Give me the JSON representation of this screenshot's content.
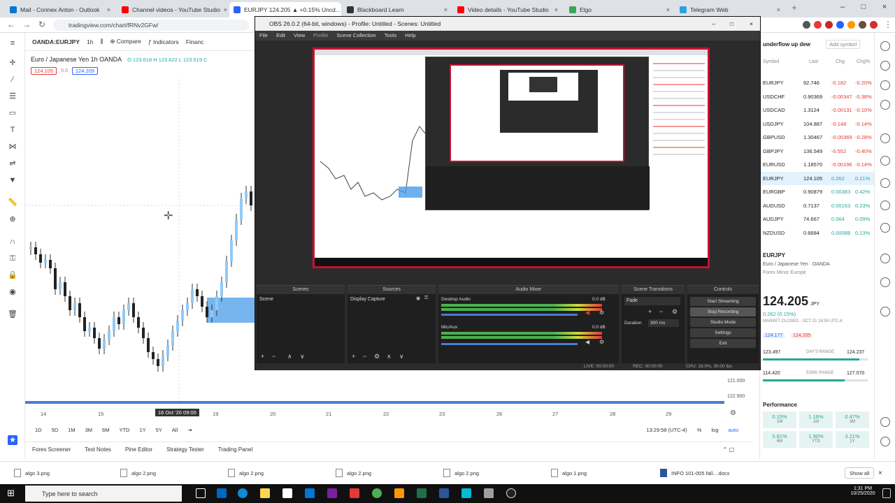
{
  "browser": {
    "tabs": [
      {
        "label": "Mail - Corinex Anton - Outlook",
        "fav": "#0078d4"
      },
      {
        "label": "Channel videos - YouTube Studio",
        "fav": "#ff0000"
      },
      {
        "label": "EURJPY 124.205 ▲ +0.15% Uncd...",
        "fav": "#2962ff"
      },
      {
        "label": "Blackboard Learn",
        "fav": "#333333"
      },
      {
        "label": "Video details - YouTube Studio",
        "fav": "#ff0000"
      },
      {
        "label": "Elgo",
        "fav": "#34a853"
      },
      {
        "label": "Telegram Web",
        "fav": "#2aa3df"
      }
    ],
    "url": "tradingview.com/chart/fRNv2GFw/"
  },
  "tv": {
    "symbol": "OANDA:EURJPY",
    "interval": "1h",
    "compare": "Compare",
    "indicators": "Indicators",
    "financials": "Financ",
    "pair_title": "Euro / Japanese Yen   1h   OANDA",
    "ohlc": "O 123.618  H 123.622  L 123.519  C",
    "sell_price": "124.105",
    "spread": "0.0",
    "buy_price": "124.209",
    "time_labels": [
      "14",
      "15",
      "16 Oct '20  09:00",
      "19",
      "20",
      "21",
      "22",
      "23",
      "26",
      "27",
      "28",
      "29"
    ],
    "price_labels": [
      "121.000",
      "122.900"
    ],
    "ranges": [
      "1D",
      "5D",
      "1M",
      "3M",
      "6M",
      "YTD",
      "1Y",
      "5Y",
      "All"
    ],
    "clock": "13:29:58 (UTC-4)",
    "log": "log",
    "auto": "auto",
    "bottom_tabs": [
      "Forex Screener",
      "Text Notes",
      "Pine Editor",
      "Strategy Tester",
      "Trading Panel"
    ]
  },
  "watchlist": {
    "title": "underflow up dew",
    "add_symbol": "Add symbol",
    "headers": [
      "Symbol",
      "Last",
      "Chg",
      "Chg%"
    ],
    "rows": [
      {
        "sym": "EURJPY",
        "last": "92.746",
        "chg": "-0.182",
        "pct": "-0.20%",
        "color": "#e53935"
      },
      {
        "sym": "USDCHF",
        "last": "0.90369",
        "chg": "-0.00347",
        "pct": "-0.38%",
        "color": "#e53935"
      },
      {
        "sym": "USDCAD",
        "last": "1.3124",
        "chg": "-0.00131",
        "pct": "-0.10%",
        "color": "#e53935"
      },
      {
        "sym": "USDJPY",
        "last": "104.887",
        "chg": "-0.148",
        "pct": "-0.14%",
        "color": "#e53935"
      },
      {
        "sym": "GBPUSD",
        "last": "1.30467",
        "chg": "-0.00369",
        "pct": "-0.28%",
        "color": "#e53935"
      },
      {
        "sym": "GBPJPY",
        "last": "136.549",
        "chg": "-0.552",
        "pct": "-0.40%",
        "color": "#e53935"
      },
      {
        "sym": "EURUSD",
        "last": "1.18570",
        "chg": "-0.00196",
        "pct": "-0.14%",
        "color": "#e53935"
      },
      {
        "sym": "EURJPY",
        "last": "124.105",
        "chg": "0.262",
        "pct": "0.21%",
        "color": "#26a69a"
      },
      {
        "sym": "EURGBP",
        "last": "0.90879",
        "chg": "0.00383",
        "pct": "0.42%",
        "color": "#26a69a"
      },
      {
        "sym": "AUDUSD",
        "last": "0.7137",
        "chg": "0.00163",
        "pct": "0.23%",
        "color": "#26a69a"
      },
      {
        "sym": "AUDJPY",
        "last": "74.667",
        "chg": "0.064",
        "pct": "0.09%",
        "color": "#26a69a"
      },
      {
        "sym": "NZDUSD",
        "last": "0.6684",
        "chg": "0.00088",
        "pct": "0.13%",
        "color": "#26a69a"
      }
    ],
    "detail_symbol": "EURJPY",
    "detail_name": "Euro / Japanese Yen · OANDA",
    "detail_sub": "Forex  Minor  Europe",
    "big_price": "124.205",
    "big_unit": "JPY",
    "big_change": "0.262 (0.15%)",
    "market_status": "MARKET CLOSED · OCT 21 16:59 UTC-4",
    "bid": "124.177",
    "ask": "124.205",
    "day_low": "123.497",
    "day_range_label": "DAY'S RANGE",
    "day_high": "124.237",
    "wk_low": "114.420",
    "wk_range_label": "52WK RANGE",
    "wk_high": "127.070",
    "perf_title": "Performance",
    "perf": [
      {
        "v": "0.15%",
        "l": "1W",
        "up": true
      },
      {
        "v": "1.16%",
        "l": "1M",
        "up": true
      },
      {
        "v": "0.47%",
        "l": "3M",
        "up": true
      },
      {
        "v": "5.81%",
        "l": "6M",
        "up": true
      },
      {
        "v": "1.90%",
        "l": "YTD",
        "up": true
      },
      {
        "v": "3.21%",
        "l": "1Y",
        "up": true
      }
    ]
  },
  "obs": {
    "title": "OBS 26.0.2 (64-bit, windows) - Profile: Untitled - Scenes: Untitled",
    "menu": [
      "File",
      "Edit",
      "View",
      "Profile",
      "Scene Collection",
      "Tools",
      "Help"
    ],
    "docks": {
      "scenes": "Scenes",
      "sources": "Sources",
      "mixer": "Audio Mixer",
      "transitions": "Scene Transitions",
      "controls": "Controls"
    },
    "scene_item": "Scene",
    "source_item": "Display Capture",
    "desktop_audio": "Desktop Audio",
    "mic_aux": "Mic/Aux",
    "desktop_db": "0.0 dB",
    "mic_db": "0.0 dB",
    "transition": "Fade",
    "duration_label": "Duration",
    "duration_value": "300 ms",
    "controls": [
      "Start Streaming",
      "Stop Recording",
      "Studio Mode",
      "Settings",
      "Exit"
    ],
    "status": {
      "live": "LIVE: 00:00:00",
      "rec": "REC: 00:00:00",
      "cpu": "CPU: 18.0%, 30.00 fps"
    }
  },
  "downloads": {
    "items": [
      "algo 3.png",
      "algo 2.png",
      "algo 2.png",
      "algo 2.png",
      "algo 2.png",
      "algo 1.png",
      "INFO 101-005 fall....docx"
    ],
    "show_all": "Show all"
  },
  "taskbar": {
    "search_placeholder": "Type here to search",
    "time": "1:31 PM",
    "date": "10/25/2020"
  },
  "colors": {
    "accent": "#2962ff",
    "up": "#26a69a",
    "down": "#e53935",
    "obs_red": "#c8102e"
  }
}
